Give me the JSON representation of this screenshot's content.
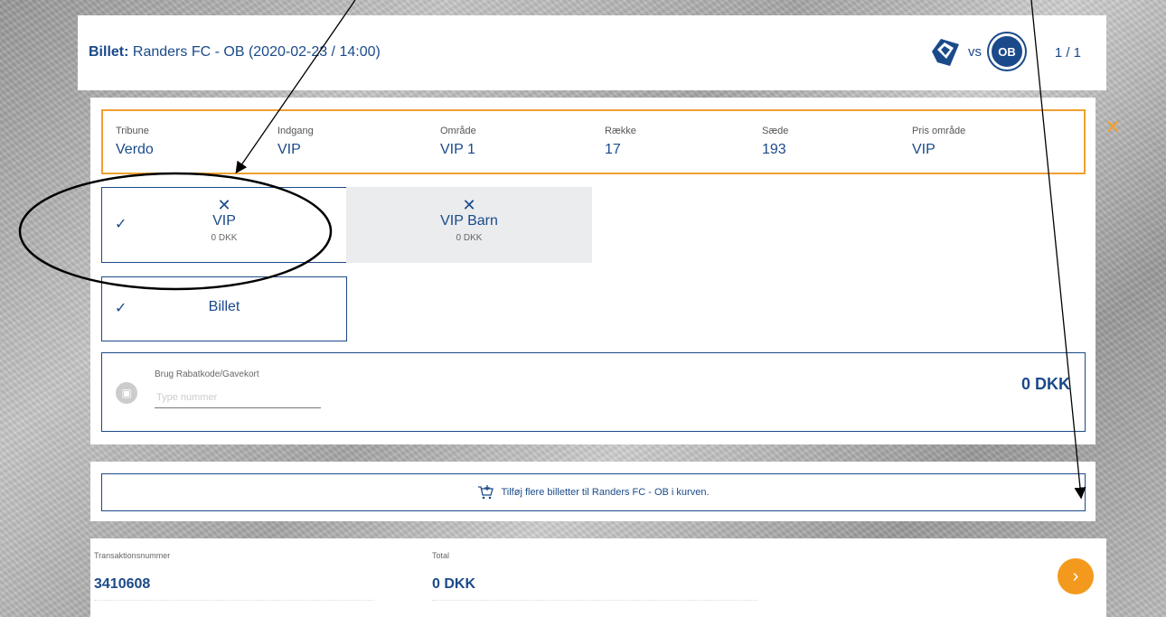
{
  "header": {
    "title_prefix": "Billet:",
    "title_text": "Randers FC - OB (2020-02-23 / 14:00)",
    "vs": "vs",
    "away_logo_text": "OB",
    "counter": "1 / 1"
  },
  "seat": {
    "fields": [
      {
        "label": "Tribune",
        "value": "Verdo"
      },
      {
        "label": "Indgang",
        "value": "VIP"
      },
      {
        "label": "Område",
        "value": "VIP 1"
      },
      {
        "label": "Række",
        "value": "17"
      },
      {
        "label": "Sæde",
        "value": "193"
      },
      {
        "label": "Pris område",
        "value": "VIP"
      }
    ],
    "close": "✕"
  },
  "options": {
    "tiles": [
      {
        "name": "VIP",
        "price": "0 DKK",
        "selected": true,
        "check": "✓"
      },
      {
        "name": "VIP Barn",
        "price": "0 DKK",
        "selected": false
      }
    ],
    "billet": {
      "name": "Billet",
      "check": "✓"
    }
  },
  "promo": {
    "label": "Brug Rabatkode/Gavekort",
    "placeholder": "Type nummer",
    "total": "0 DKK"
  },
  "add": {
    "label": "Tilføj flere billetter til Randers FC - OB i kurven."
  },
  "footer": {
    "transaction_label": "Transaktionsnummer",
    "transaction_value": "3410608",
    "total_label": "Total",
    "total_value": "0 DKK",
    "next": "›"
  },
  "colors": {
    "brand": "#1a4a8a",
    "accent": "#f0a030",
    "next_button": "#f39a1e"
  }
}
